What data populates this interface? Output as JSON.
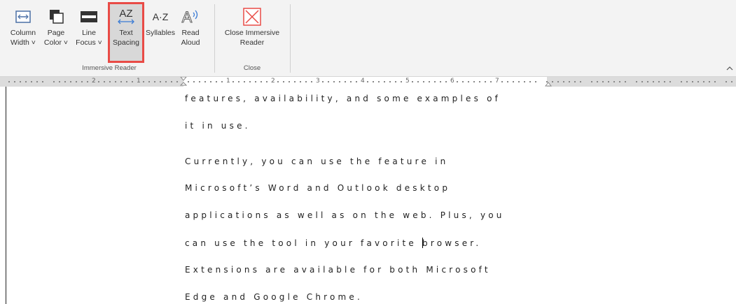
{
  "ribbon": {
    "buttons": [
      {
        "id": "column-width",
        "line1": "Column",
        "line2": "Width ˅"
      },
      {
        "id": "page-color",
        "line1": "Page",
        "line2": "Color ˅"
      },
      {
        "id": "line-focus",
        "line1": "Line",
        "line2": "Focus ˅"
      },
      {
        "id": "text-spacing",
        "line1": "Text",
        "line2": "Spacing"
      },
      {
        "id": "syllables",
        "line1": "Syllables",
        "line2": ""
      },
      {
        "id": "read-aloud",
        "line1": "Read",
        "line2": "Aloud"
      },
      {
        "id": "close-immersive-reader",
        "line1": "Close Immersive",
        "line2": "Reader"
      }
    ],
    "groups": {
      "immersive_reader": "Immersive Reader",
      "close": "Close"
    },
    "icons": {
      "text_spacing_glyph": "AZ",
      "syllables_glyph": "A·Z",
      "read_aloud_glyph": "A"
    },
    "accent_color": "#e94b46"
  },
  "ruler": {
    "labels_left": [
      "2",
      "1"
    ],
    "labels_right": [
      "1",
      "2",
      "3",
      "4",
      "5",
      "6",
      "7"
    ]
  },
  "document": {
    "lines": [
      "features, availability, and some examples of",
      "it in use.",
      "Currently, you can use the feature in",
      "Microsoft’s Word and Outlook desktop",
      "applications as well as on the web. Plus, you",
      "can use the tool in your favorite ",
      "browser.",
      "Extensions are available for both Microsoft",
      "Edge and Google Chrome."
    ]
  }
}
